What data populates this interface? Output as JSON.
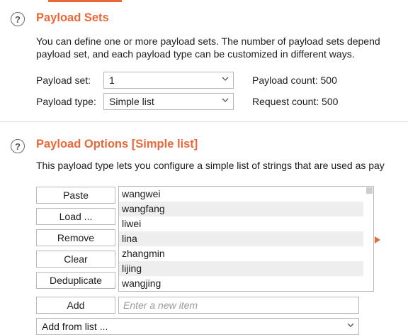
{
  "payload_sets": {
    "title": "Payload Sets",
    "description_line1": "You can define one or more payload sets. The number of payload sets depend",
    "description_line2": "payload set, and each payload type can be customized in different ways.",
    "payload_set_label": "Payload set:",
    "payload_set_value": "1",
    "payload_type_label": "Payload type:",
    "payload_type_value": "Simple list",
    "payload_count": "Payload count: 500",
    "request_count": "Request count: 500"
  },
  "payload_options": {
    "title": "Payload Options [Simple list]",
    "description": "This payload type lets you configure a simple list of strings that are used as pay",
    "buttons": {
      "paste": "Paste",
      "load": "Load ...",
      "remove": "Remove",
      "clear": "Clear",
      "deduplicate": "Deduplicate",
      "add": "Add"
    },
    "items": [
      "wangwei",
      "wangfang",
      "liwei",
      "lina",
      "zhangmin",
      "lijing",
      "wangjing"
    ],
    "new_item_placeholder": "Enter a new item",
    "add_from_list": "Add from list ..."
  },
  "icons": {
    "help": "?",
    "help_icon_name": "help-circle-icon",
    "dropdown_icon_name": "chevron-down-icon"
  },
  "colors": {
    "accent": "#e8683a",
    "border": "#b9b9b9",
    "alt_row": "#eeeeee"
  }
}
